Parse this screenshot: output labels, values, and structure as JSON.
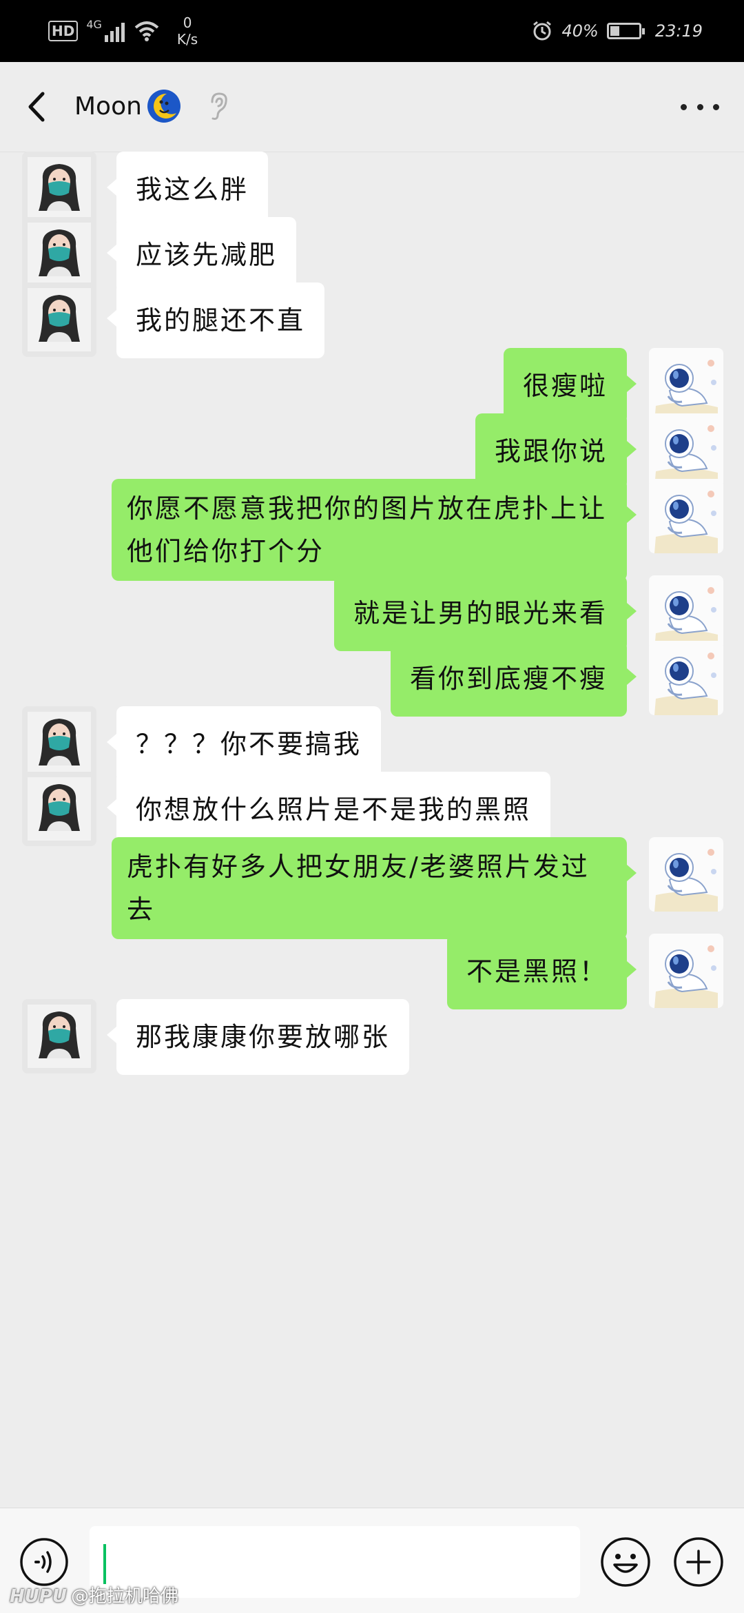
{
  "status_bar": {
    "hd": "HD",
    "network": "4G",
    "speed_value": "0",
    "speed_unit": "K/s",
    "battery": "40%",
    "time": "23:19"
  },
  "header": {
    "title": "Moon"
  },
  "messages": [
    {
      "side": "left",
      "text": "我这么胖"
    },
    {
      "side": "left",
      "text": "应该先减肥"
    },
    {
      "side": "left",
      "text": "我的腿还不直"
    },
    {
      "side": "right",
      "text": "很瘦啦"
    },
    {
      "side": "right",
      "text": "我跟你说"
    },
    {
      "side": "right",
      "text": "你愿不愿意我把你的图片放在虎扑上让他们给你打个分"
    },
    {
      "side": "right",
      "text": "就是让男的眼光来看"
    },
    {
      "side": "right",
      "text": "看你到底瘦不瘦"
    },
    {
      "side": "left",
      "text": "？？？你不要搞我"
    },
    {
      "side": "left",
      "text": "你想放什么照片是不是我的黑照"
    },
    {
      "side": "right",
      "text": "虎扑有好多人把女朋友/老婆照片发过去"
    },
    {
      "side": "right",
      "text": "不是黑照！"
    },
    {
      "side": "left",
      "text": "那我康康你要放哪张"
    }
  ],
  "input": {
    "value": ""
  },
  "watermark": {
    "brand": "HUPU",
    "handle": "@拖拉机哈佛"
  },
  "colors": {
    "sent_bubble": "#95ec69",
    "received_bubble": "#ffffff",
    "background": "#ededed"
  }
}
